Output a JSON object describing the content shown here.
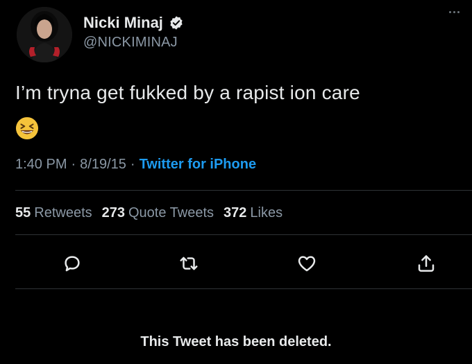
{
  "author": {
    "display_name": "Nicki Minaj",
    "handle": "@NICKIMINAJ",
    "verified": true,
    "avatar_icon": "profile-photo"
  },
  "tweet": {
    "text": "I’m tryna get fukked by a rapist ion care",
    "emoji": "😆"
  },
  "meta": {
    "time": "1:40 PM",
    "separator": "·",
    "date": "8/19/15",
    "source": "Twitter for iPhone"
  },
  "stats": {
    "retweets_count": "55",
    "retweets_label": "Retweets",
    "quotes_count": "273",
    "quotes_label": "Quote Tweets",
    "likes_count": "372",
    "likes_label": "Likes"
  },
  "actions": {
    "reply_icon": "reply-icon",
    "retweet_icon": "retweet-icon",
    "like_icon": "heart-icon",
    "share_icon": "share-icon"
  },
  "notice": {
    "deleted_text": "This Tweet has been deleted."
  },
  "colors": {
    "background": "#000000",
    "text": "#e7e9ea",
    "muted": "#8b98a5",
    "link": "#1d9bf0",
    "divider": "#2f3336"
  }
}
